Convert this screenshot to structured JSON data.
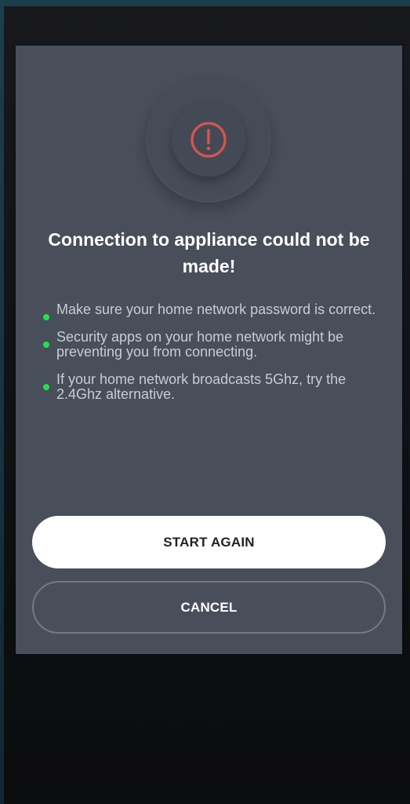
{
  "dialog": {
    "title": "Connection to appliance could not be made!",
    "icon": "exclamation-circle-icon",
    "icon_color": "#d9534f",
    "tip_bullet_color": "#22e14a",
    "tips": [
      "Make sure your home network password is correct.",
      "Security apps on your home network might be preventing you from connecting.",
      "If your home network broadcasts 5Ghz, try the 2.4Ghz alternative."
    ],
    "buttons": {
      "start_again": "START AGAIN",
      "cancel": "CANCEL"
    }
  }
}
